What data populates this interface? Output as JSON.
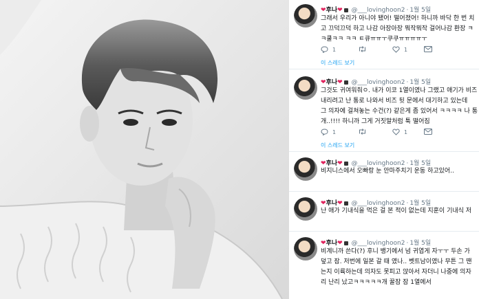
{
  "tweets": [
    {
      "name": "후나",
      "handle": "@___lovinghoon2",
      "date": "1월 5일",
      "lines": [
        "그래서 우리가 아니야 됐어! 떨어졌어! 하니까 바닥 한 번 치",
        "고 끄덕끄덕 하고 나감 아장아장 뭐작뭐작 걸어나감 환장 ㅋ",
        "ㅋ쿨ㅋㅋ ㅋㅋ ㅌ큐ㅠㅠㅜ쿠쿠ㅠㅠㅠㅠㅜ"
      ],
      "reply_count": "1",
      "like_count": "1",
      "thread": "이 스레드 보기"
    },
    {
      "name": "후나",
      "handle": "@___lovinghoon2",
      "date": "1월 5일",
      "lines": [
        "그것도 귀여워줘ㅇ. 내가 이코 1열이였나 그랬고 애기가 비즈",
        "내리려고 난 통로 나와서 비즈 뒷 문에서 대기하고 있는데",
        "그 의자에 걸쳐놓는 수건(?) 같은게 좀 있어서 ㅋㅋㅋㅋ 나 통",
        "개..!!!! 하니까 그게 거짓말처럼 툭 떨어짐"
      ],
      "reply_count": "1",
      "like_count": "1",
      "thread": "이 스레드 보기"
    },
    {
      "name": "후나",
      "handle": "@___lovinghoon2",
      "date": "1월 5일",
      "lines": [
        "비지니스에서 오빠랑 눈 안마주치기 운동 하고있어.."
      ]
    },
    {
      "name": "후나",
      "handle": "@___lovinghoon2",
      "date": "1월 5일",
      "lines": [
        "난 애가 기내식을 먹은 걸 본 적이 없는데 지훈이 기내식 저"
      ]
    },
    {
      "name": "후나",
      "handle": "@___lovinghoon2",
      "date": "1월 5일",
      "lines": [
        "비계니까 쓴다(?) 후니 뱅기에서 넘 귀엽게 자ㅜㅜ 두손 가",
        "덮고 잠. 저번에 일본 갈 때 였나.. 벳트남이였나 무튼 그 땐",
        "는지 이륙하는데 의자도 못피고 앉아서 자더니 나중에 의자",
        "리 난리 났고ㅋㅋㅋㅋㅋ개 꿀잠 잠 1열에서"
      ]
    }
  ]
}
